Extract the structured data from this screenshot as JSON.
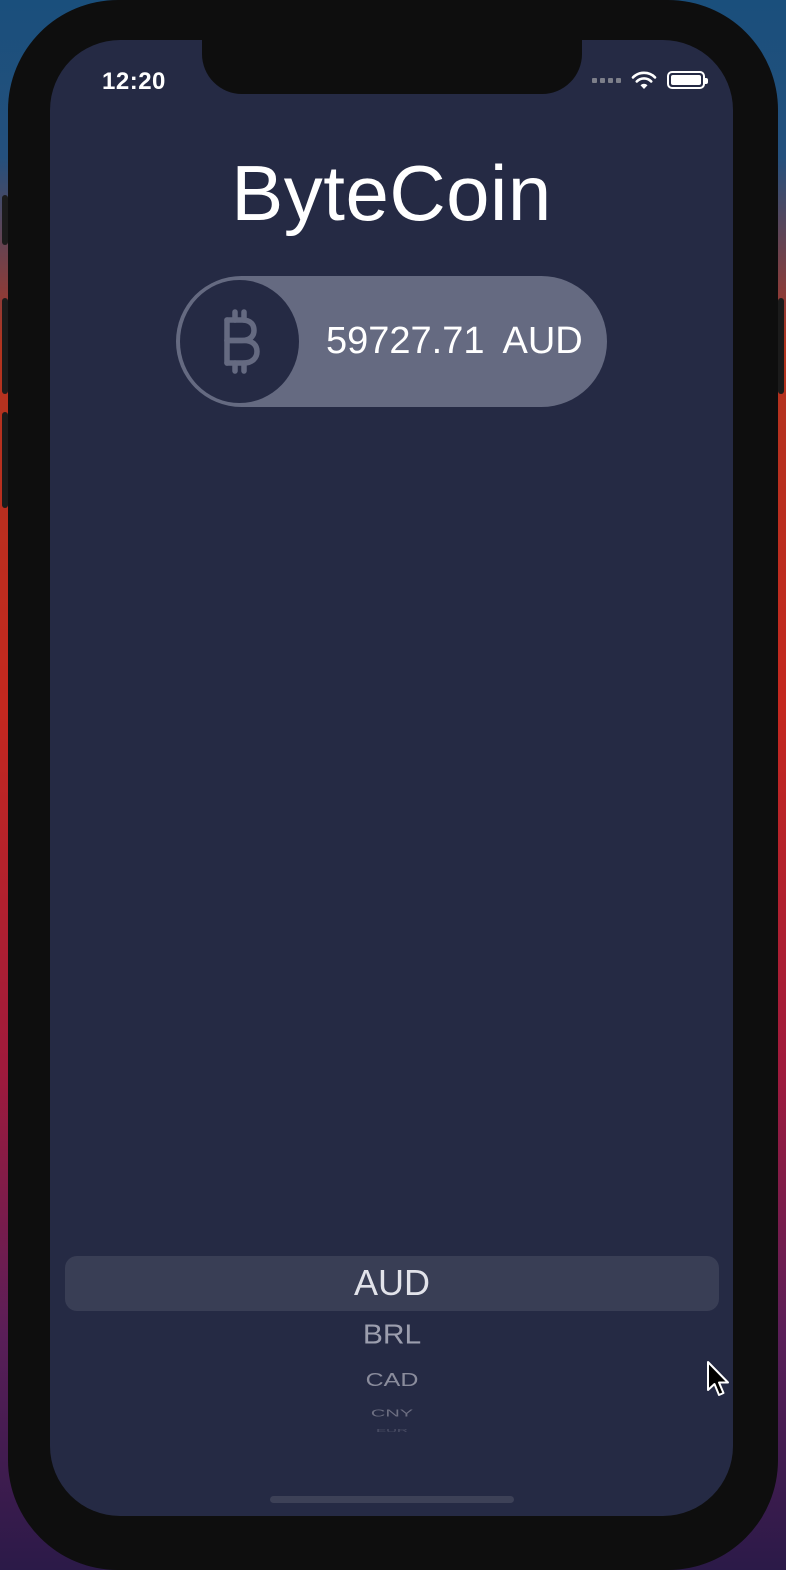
{
  "status_bar": {
    "time": "12:20",
    "icons": [
      "signal-icon",
      "wifi-icon",
      "battery-icon"
    ]
  },
  "app": {
    "title": "ByteCoin"
  },
  "rate": {
    "coin_icon": "bitcoin-icon",
    "value": "59727.71",
    "currency": "AUD"
  },
  "picker": {
    "selected": "AUD",
    "items": [
      "AUD",
      "BRL",
      "CAD",
      "CNY",
      "EUR"
    ]
  },
  "colors": {
    "background": "#252a44",
    "pill": "#656a81",
    "text": "#ffffff"
  }
}
